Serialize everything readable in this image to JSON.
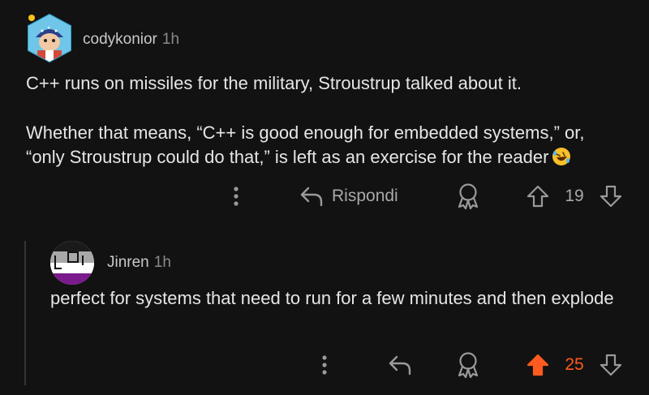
{
  "comments": [
    {
      "username": "codykonior",
      "time": "1h",
      "body_lines": [
        "C++ runs on missiles for the military, Stroustrup talked about it.",
        "Whether that means, “C++ is good enough for embedded systems,” or, “only Stroustrup could do that,” is left as an exercise for the reader"
      ],
      "emoji_icon": "rolling-on-floor-laughing-emoji",
      "actions": {
        "more_icon": "more-vertical-icon",
        "reply_label": "Rispondi",
        "award_icon": "award-icon",
        "score": "19",
        "upvoted": false
      }
    },
    {
      "username": "Jinren",
      "time": "1h",
      "body": "perfect for systems that need to run for a few minutes and then explode",
      "actions": {
        "more_icon": "more-vertical-icon",
        "award_icon": "award-icon",
        "score": "25",
        "upvoted": true
      }
    }
  ],
  "colors": {
    "background": "#121212",
    "upvote_active": "#ff5a1f",
    "muted": "#9a9a9a",
    "thread_line": "#343434"
  }
}
